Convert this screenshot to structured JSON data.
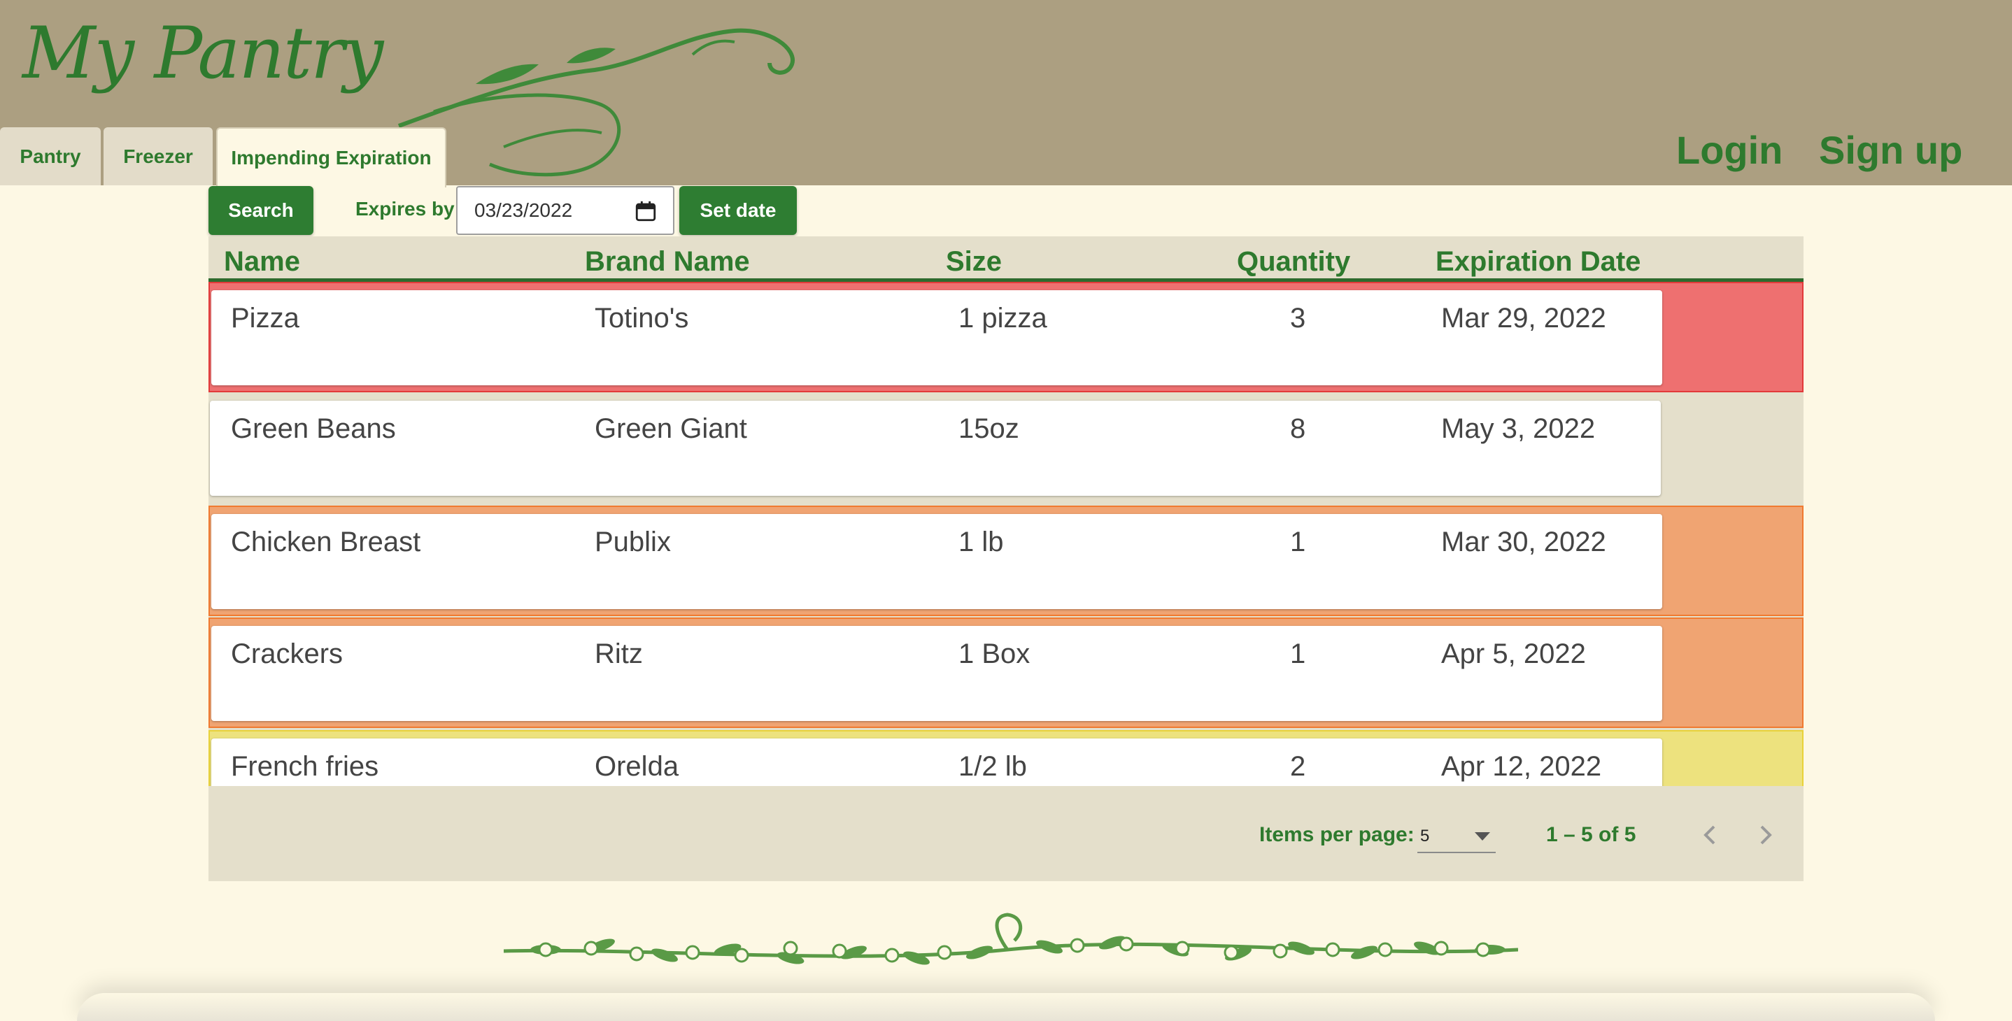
{
  "app": {
    "title": "My Pantry"
  },
  "tabs": [
    {
      "label": "Pantry",
      "active": false
    },
    {
      "label": "Freezer",
      "active": false
    },
    {
      "label": "Impending Expiration",
      "active": true
    }
  ],
  "auth": {
    "login": "Login",
    "signup": "Sign up"
  },
  "toolbar": {
    "search": "Search",
    "expires_label": "Expires by:",
    "expires_value": "03/23/2022",
    "set_date": "Set date"
  },
  "table": {
    "headers": [
      "Name",
      "Brand Name",
      "Size",
      "Quantity",
      "Expiration Date"
    ],
    "rows": [
      {
        "name": "Pizza",
        "brand": "Totino's",
        "size": "1 pizza",
        "quantity": "3",
        "expiration": "Mar 29, 2022",
        "status_color": "#ee7070"
      },
      {
        "name": "Green Beans",
        "brand": "Green Giant",
        "size": "15oz",
        "quantity": "8",
        "expiration": "May 3, 2022",
        "status_color": "#e4dfcb"
      },
      {
        "name": "Chicken Breast",
        "brand": "Publix",
        "size": "1 lb",
        "quantity": "1",
        "expiration": "Mar 30, 2022",
        "status_color": "#f0a472"
      },
      {
        "name": "Crackers",
        "brand": "Ritz",
        "size": "1 Box",
        "quantity": "1",
        "expiration": "Apr 5, 2022",
        "status_color": "#f0a472"
      },
      {
        "name": "French fries",
        "brand": "Orelda",
        "size": "1/2 lb",
        "quantity": "2",
        "expiration": "Apr 12, 2022",
        "status_color": "#ede27e"
      }
    ]
  },
  "paginator": {
    "items_per_page_label": "Items per page:",
    "items_per_page_value": "5",
    "range_label": "1 – 5 of 5"
  },
  "colors": {
    "header_bg": "#ac9f81",
    "page_bg": "#fdf8e4",
    "accent_green": "#2e7d32",
    "table_bg": "#e4dfcb"
  }
}
